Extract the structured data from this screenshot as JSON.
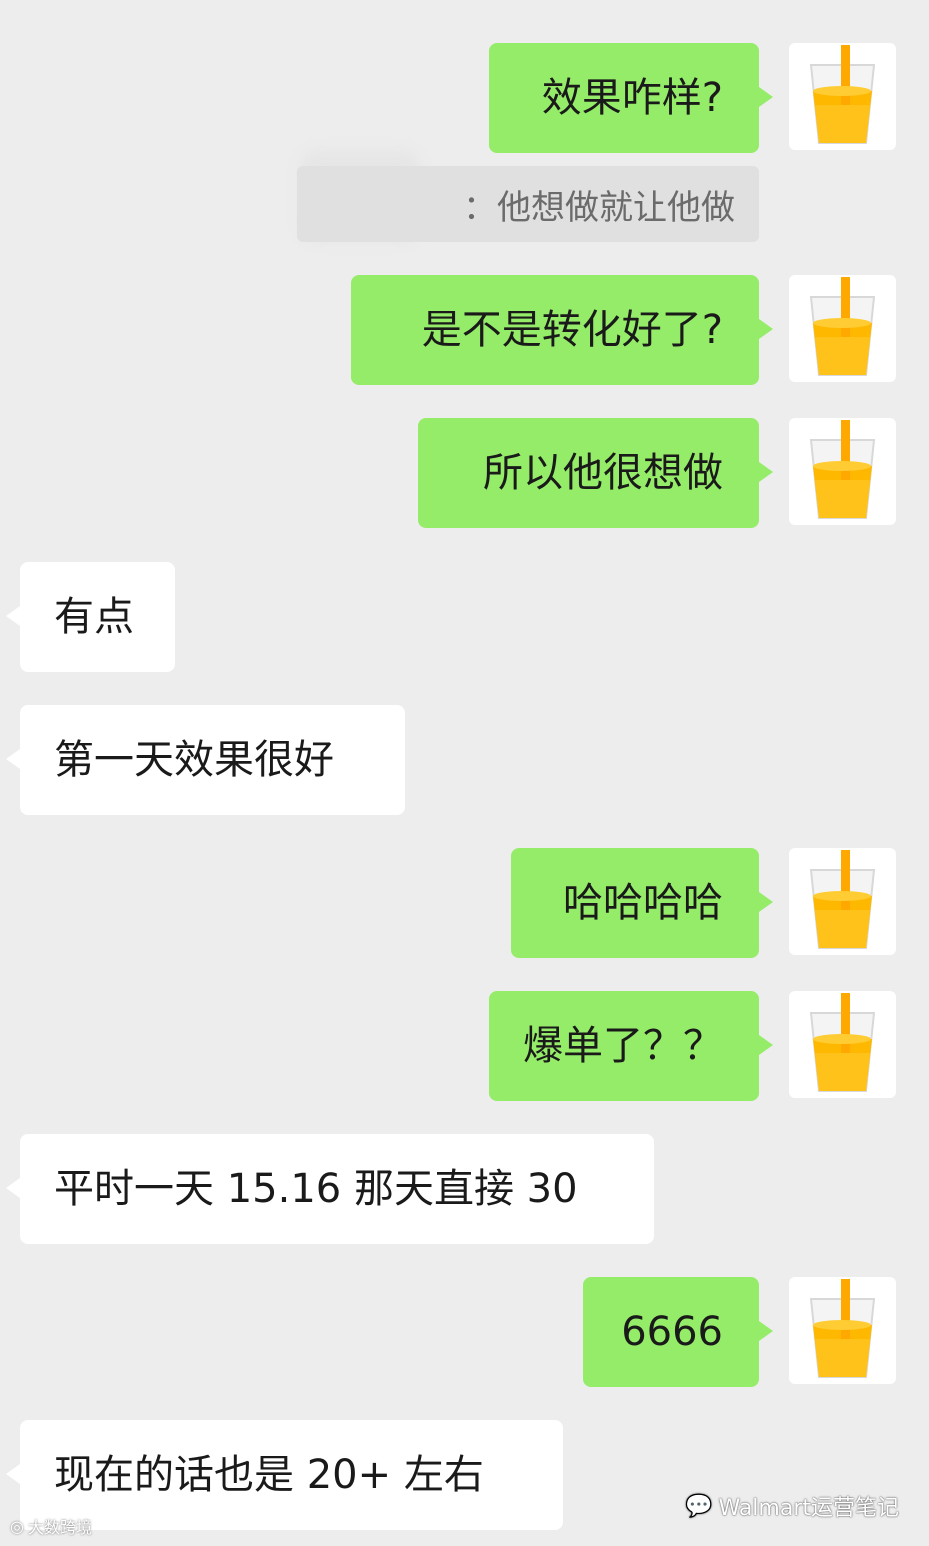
{
  "messages": {
    "m1": "效果咋样?",
    "quote": "：他想做就让他做",
    "m2": "是不是转化好了?",
    "m3": "所以他很想做",
    "m4": "有点",
    "m5": "第一天效果很好",
    "m6": "哈哈哈哈",
    "m7": "爆单了？？",
    "m8": "平时一天 15.16 那天直接 30",
    "m9": "6666",
    "m10": "现在的话也是 20+ 左右"
  },
  "avatar_icon": "orange-juice-glass-icon",
  "colors": {
    "background": "#ededed",
    "outgoing_bubble": "#95ec69",
    "incoming_bubble": "#ffffff",
    "quote_bg": "#e0e0e0"
  },
  "watermark": {
    "right": "Walmart运营笔记",
    "left": "大数跨境"
  }
}
